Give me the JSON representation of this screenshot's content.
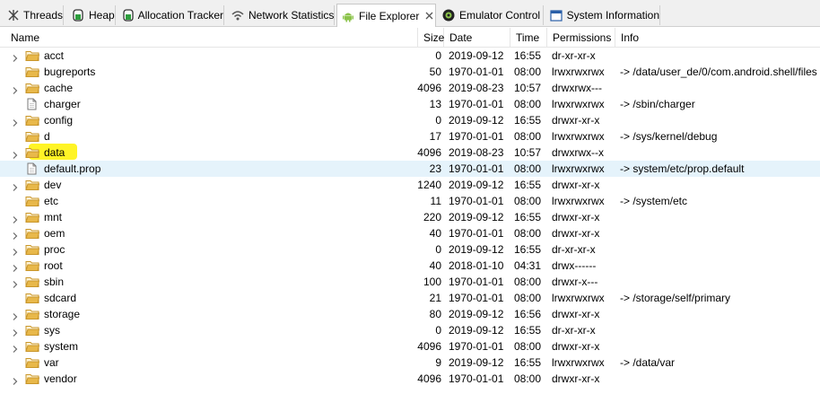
{
  "tabs": [
    {
      "label": "Threads",
      "icon": "threads-icon"
    },
    {
      "label": "Heap",
      "icon": "heap-icon"
    },
    {
      "label": "Allocation Tracker",
      "icon": "allocation-tracker-icon"
    },
    {
      "label": "Network Statistics",
      "icon": "network-statistics-icon"
    },
    {
      "label": "File Explorer",
      "icon": "android-icon",
      "active": true
    },
    {
      "label": "Emulator Control",
      "icon": "emulator-icon"
    },
    {
      "label": "System Information",
      "icon": "system-info-icon"
    }
  ],
  "columns": {
    "name": "Name",
    "size": "Size",
    "date": "Date",
    "time": "Time",
    "permissions": "Permissions",
    "info": "Info"
  },
  "files": [
    {
      "name": "acct",
      "type": "folder",
      "expandable": true,
      "size": "0",
      "date": "2019-09-12",
      "time": "16:55",
      "permissions": "dr-xr-xr-x",
      "info": ""
    },
    {
      "name": "bugreports",
      "type": "folder",
      "expandable": false,
      "size": "50",
      "date": "1970-01-01",
      "time": "08:00",
      "permissions": "lrwxrwxrwx",
      "info": "-> /data/user_de/0/com.android.shell/files"
    },
    {
      "name": "cache",
      "type": "folder",
      "expandable": true,
      "size": "4096",
      "date": "2019-08-23",
      "time": "10:57",
      "permissions": "drwxrwx---",
      "info": ""
    },
    {
      "name": "charger",
      "type": "file",
      "expandable": false,
      "size": "13",
      "date": "1970-01-01",
      "time": "08:00",
      "permissions": "lrwxrwxrwx",
      "info": "-> /sbin/charger"
    },
    {
      "name": "config",
      "type": "folder",
      "expandable": true,
      "size": "0",
      "date": "2019-09-12",
      "time": "16:55",
      "permissions": "drwxr-xr-x",
      "info": ""
    },
    {
      "name": "d",
      "type": "folder",
      "expandable": false,
      "size": "17",
      "date": "1970-01-01",
      "time": "08:00",
      "permissions": "lrwxrwxrwx",
      "info": "-> /sys/kernel/debug"
    },
    {
      "name": "data",
      "type": "folder",
      "expandable": true,
      "size": "4096",
      "date": "2019-08-23",
      "time": "10:57",
      "permissions": "drwxrwx--x",
      "info": ""
    },
    {
      "name": "default.prop",
      "type": "file",
      "expandable": false,
      "selected": true,
      "size": "23",
      "date": "1970-01-01",
      "time": "08:00",
      "permissions": "lrwxrwxrwx",
      "info": "-> system/etc/prop.default"
    },
    {
      "name": "dev",
      "type": "folder",
      "expandable": true,
      "size": "1240",
      "date": "2019-09-12",
      "time": "16:55",
      "permissions": "drwxr-xr-x",
      "info": ""
    },
    {
      "name": "etc",
      "type": "folder",
      "expandable": false,
      "size": "11",
      "date": "1970-01-01",
      "time": "08:00",
      "permissions": "lrwxrwxrwx",
      "info": "-> /system/etc"
    },
    {
      "name": "mnt",
      "type": "folder",
      "expandable": true,
      "size": "220",
      "date": "2019-09-12",
      "time": "16:55",
      "permissions": "drwxr-xr-x",
      "info": ""
    },
    {
      "name": "oem",
      "type": "folder",
      "expandable": true,
      "size": "40",
      "date": "1970-01-01",
      "time": "08:00",
      "permissions": "drwxr-xr-x",
      "info": ""
    },
    {
      "name": "proc",
      "type": "folder",
      "expandable": true,
      "size": "0",
      "date": "2019-09-12",
      "time": "16:55",
      "permissions": "dr-xr-xr-x",
      "info": ""
    },
    {
      "name": "root",
      "type": "folder",
      "expandable": true,
      "size": "40",
      "date": "2018-01-10",
      "time": "04:31",
      "permissions": "drwx------",
      "info": ""
    },
    {
      "name": "sbin",
      "type": "folder",
      "expandable": true,
      "size": "100",
      "date": "1970-01-01",
      "time": "08:00",
      "permissions": "drwxr-x---",
      "info": ""
    },
    {
      "name": "sdcard",
      "type": "folder",
      "expandable": false,
      "size": "21",
      "date": "1970-01-01",
      "time": "08:00",
      "permissions": "lrwxrwxrwx",
      "info": "-> /storage/self/primary"
    },
    {
      "name": "storage",
      "type": "folder",
      "expandable": true,
      "size": "80",
      "date": "2019-09-12",
      "time": "16:56",
      "permissions": "drwxr-xr-x",
      "info": ""
    },
    {
      "name": "sys",
      "type": "folder",
      "expandable": true,
      "size": "0",
      "date": "2019-09-12",
      "time": "16:55",
      "permissions": "dr-xr-xr-x",
      "info": ""
    },
    {
      "name": "system",
      "type": "folder",
      "expandable": true,
      "size": "4096",
      "date": "1970-01-01",
      "time": "08:00",
      "permissions": "drwxr-xr-x",
      "info": ""
    },
    {
      "name": "var",
      "type": "folder",
      "expandable": false,
      "size": "9",
      "date": "2019-09-12",
      "time": "16:55",
      "permissions": "lrwxrwxrwx",
      "info": "-> /data/var"
    },
    {
      "name": "vendor",
      "type": "folder",
      "expandable": true,
      "size": "4096",
      "date": "1970-01-01",
      "time": "08:00",
      "permissions": "drwxr-xr-x",
      "info": ""
    }
  ],
  "colors": {
    "folder": "#e8b84a",
    "folder_dark": "#c9962a",
    "selection": "#e5f3fb",
    "highlight": "#fff200",
    "android_green": "#8bc34a"
  }
}
